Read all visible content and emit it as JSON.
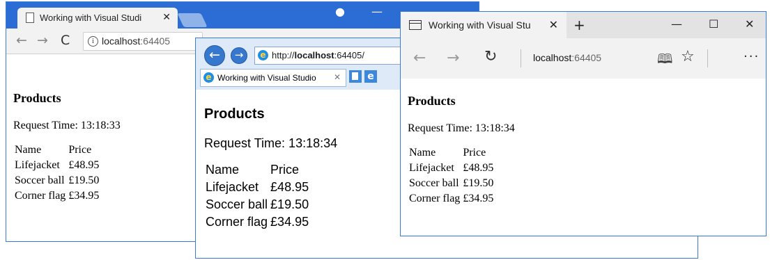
{
  "chrome": {
    "tab_title": "Working with Visual Studi",
    "tab_close": "✕",
    "profile": "●",
    "minimize": "—",
    "back": "←",
    "forward": "→",
    "reload": "C",
    "url_host": "localhost",
    "url_port": ":64405",
    "page": {
      "heading": "Products",
      "request_time": "Request Time: 13:18:33",
      "col_name": "Name",
      "col_price": "Price",
      "rows": [
        {
          "name": "Lifejacket",
          "price": "£48.95"
        },
        {
          "name": "Soccer ball",
          "price": "£19.50"
        },
        {
          "name": "Corner flag",
          "price": "£34.95"
        }
      ]
    }
  },
  "ie": {
    "back": "←",
    "forward": "→",
    "url_prefix": "http://",
    "url_host": "localhost",
    "url_suffix": ":64405/",
    "tab_title": "Working with Visual Studio",
    "tab_close": "✕",
    "page": {
      "heading": "Products",
      "request_time": "Request Time: 13:18:34",
      "col_name": "Name",
      "col_price": "Price",
      "rows": [
        {
          "name": "Lifejacket",
          "price": "£48.95"
        },
        {
          "name": "Soccer ball",
          "price": "£19.50"
        },
        {
          "name": "Corner flag",
          "price": "£34.95"
        }
      ]
    }
  },
  "edge": {
    "tab_title": "Working with Visual Stu",
    "tab_close": "✕",
    "new_tab": "+",
    "minimize": "—",
    "maximize": "☐",
    "close": "✕",
    "back": "←",
    "forward": "→",
    "refresh": "↻",
    "url_host": "localhost",
    "url_port": ":64405",
    "star": "☆",
    "more": "···",
    "page": {
      "heading": "Products",
      "request_time": "Request Time: 13:18:34",
      "col_name": "Name",
      "col_price": "Price",
      "rows": [
        {
          "name": "Lifejacket",
          "price": "£48.95"
        },
        {
          "name": "Soccer ball",
          "price": "£19.50"
        },
        {
          "name": "Corner flag",
          "price": "£34.95"
        }
      ]
    }
  },
  "colors": {
    "chrome_titlebar": "#2b6dd5",
    "window_border": "#3a7bd5",
    "ie_accent": "#3778cf"
  }
}
